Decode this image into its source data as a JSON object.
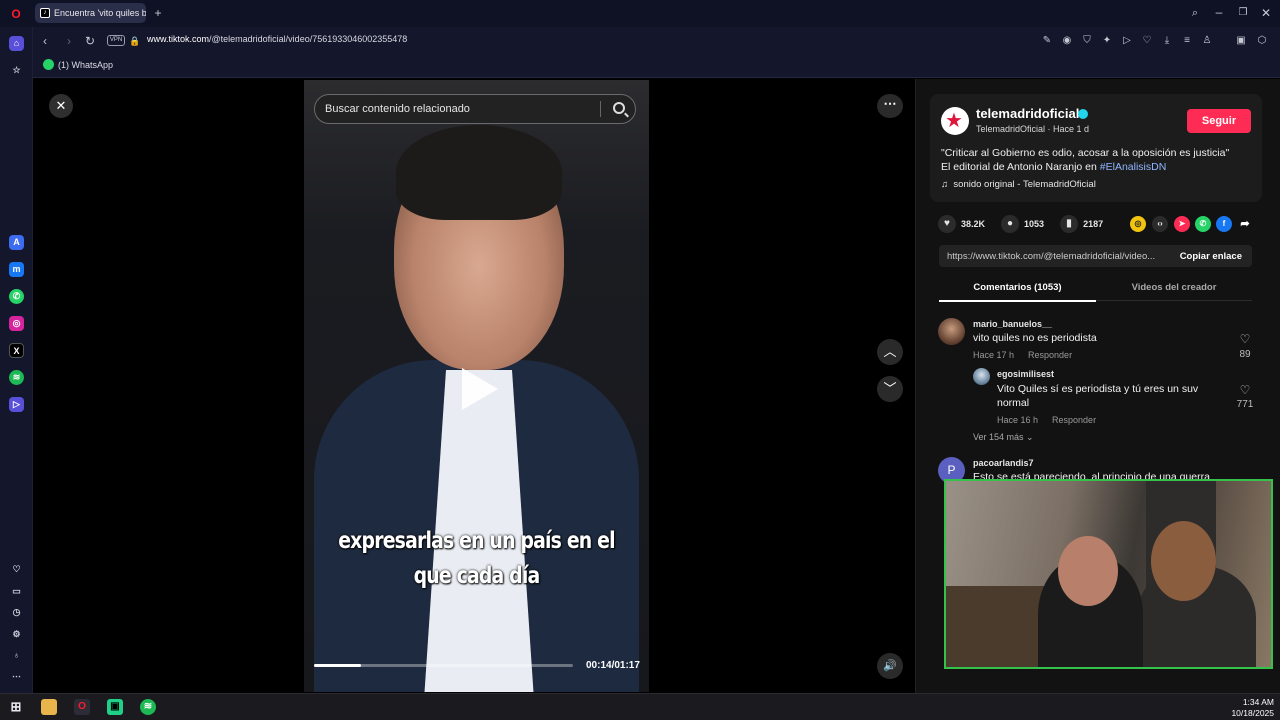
{
  "browser": {
    "tab_title": "Encuentra 'vito quiles bar",
    "url_domain": "www.tiktok.com",
    "url_path": "/@telemadridoficial/video/7561933046002355478",
    "vpn_label": "VPN",
    "bookmark_label": "(1) WhatsApp"
  },
  "viewer": {
    "search_placeholder": "Buscar contenido relacionado",
    "caption_line1": "expresarlas en un país en el",
    "caption_line2": "que cada día",
    "time": "00:14/01:17",
    "progress": 0.18
  },
  "panel": {
    "username": "telemadridoficial",
    "subtitle": "TelemadridOficial · Hace 1 d",
    "follow_label": "Seguir",
    "desc_line1": "\"Criticar al Gobierno es odio, acosar a la oposición es justicia\"",
    "desc_line2_prefix": "El editorial de Antonio Naranjo en",
    "desc_hashtag": "#ElAnalisisDN",
    "sound": "sonido original - TelemadridOficial",
    "likes": "38.2K",
    "comments": "1053",
    "saves": "2187",
    "link": "https://www.tiktok.com/@telemadridoficial/video...",
    "copy_label": "Copiar enlace",
    "tab_comments": "Comentarios (1053)",
    "tab_creator": "Videos del creador"
  },
  "comments": [
    {
      "user": "mario_banuelos__",
      "text": "vito quiles no es periodista",
      "time": "Hace 17 h",
      "reply": "Responder",
      "likes": "89"
    },
    {
      "user": "egosimilisest",
      "text_line1": "Vito Quiles sí es periodista y tú eres un suv",
      "text_line2": "normal",
      "time": "Hace 16 h",
      "reply": "Responder",
      "likes": "771"
    },
    {
      "more": "Ver 154 más"
    },
    {
      "user": "pacoarlandis7",
      "text": "Esto se está pareciendo, al principio de una guerra"
    }
  ],
  "taskbar": {
    "time": "1:34 AM",
    "date": "10/18/2025"
  },
  "colors": {
    "accent": "#fe2c55",
    "hashtag": "#8fb6ff",
    "cam_border": "#35c24a"
  }
}
